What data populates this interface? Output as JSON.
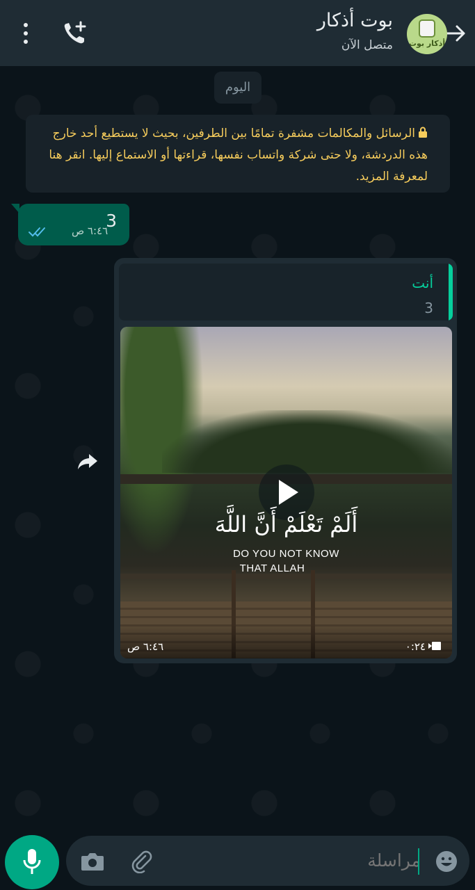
{
  "header": {
    "contact_name": "بوت أذكار",
    "status": "متصل الآن",
    "avatar_text": "أذكار بوت"
  },
  "chat": {
    "date_chip": "اليوم",
    "encryption_notice": "الرسائل والمكالمات مشفرة تمامًا بين الطرفين، بحيث لا يستطيع أحد خارج هذه الدردشة، ولا حتى شركة واتساب نفسها، قراءتها أو الاستماع إليها. انقر هنا لمعرفة المزيد.",
    "sent_message": {
      "text": "3",
      "time": "٦:٤٦ ص",
      "status_icon": "double-check-read-icon"
    },
    "reply_message": {
      "quote_author": "أنت",
      "quote_text": "3",
      "video": {
        "caption_arabic": "أَلَمْ تَعْلَمْ أَنَّ اللَّهَ",
        "caption_english_line1": "DO YOU NOT KNOW",
        "caption_english_line2": "THAT ALLAH",
        "duration": "٠:٢٤",
        "time": "٦:٤٦ ص"
      }
    }
  },
  "composer": {
    "placeholder": "مراسلة"
  },
  "colors": {
    "header_bg": "#1f2c34",
    "chat_bg": "#0b141a",
    "outgoing_bubble": "#005c4b",
    "accent": "#00a884",
    "notice_text": "#f7cd5c",
    "quote_author": "#06cf9c"
  },
  "icons": [
    "back-arrow-icon",
    "add-call-icon",
    "more-options-icon",
    "lock-icon",
    "play-icon",
    "forward-icon",
    "emoji-icon",
    "attach-icon",
    "camera-icon",
    "mic-icon",
    "video-camera-icon",
    "double-check-read-icon"
  ]
}
